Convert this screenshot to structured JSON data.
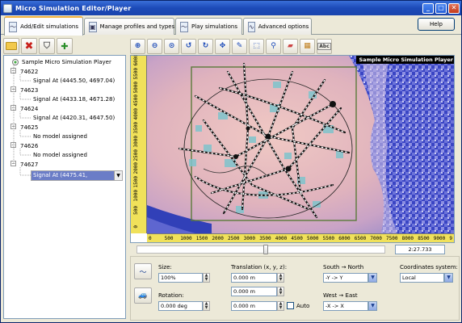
{
  "window": {
    "title": "Micro Simulation Editor/Player"
  },
  "tabs": [
    {
      "label": "Add/Edit simulations",
      "icon": "line-chart-icon"
    },
    {
      "label": "Manage profiles and types",
      "icon": "car-types-icon"
    },
    {
      "label": "Play simulations",
      "icon": "play-chart-icon"
    },
    {
      "label": "Advanced options",
      "icon": "advanced-chart-icon"
    }
  ],
  "help_label": "Help",
  "tree": {
    "root": "Sample Micro Simulation Player",
    "nodes": [
      {
        "id": "74622",
        "child": "Signal At (4445.50, 4697.04)"
      },
      {
        "id": "74623",
        "child": "Signal At (4433.18, 4671.28)"
      },
      {
        "id": "74624",
        "child": "Signal At (4420.31, 4647.50)"
      },
      {
        "id": "74625",
        "child": "No model assigned"
      },
      {
        "id": "74626",
        "child": "No model assigned"
      },
      {
        "id": "74627",
        "child": "Signal At (4475.41, 4692.98)"
      }
    ]
  },
  "map": {
    "badge": "Sample Micro Simulation Player",
    "v_ruler": [
      "0",
      "500",
      "1000",
      "1500",
      "2000",
      "2500",
      "3000",
      "3500",
      "4000",
      "4500",
      "5000",
      "5500",
      "6000"
    ],
    "h_ruler": [
      "0",
      "500",
      "1000",
      "1500",
      "2000",
      "2500",
      "3000",
      "3500",
      "4000",
      "4500",
      "5000",
      "5500",
      "6000",
      "6500",
      "7000",
      "7500",
      "8000",
      "8500",
      "9000",
      "9"
    ]
  },
  "playback": {
    "time": "2:27.733",
    "position": 0.52
  },
  "props": {
    "size_label": "Size:",
    "size_value": "100%",
    "rotation_label": "Rotation:",
    "rotation_value": "0.000 deg",
    "translation_label": "Translation (x, y, z):",
    "tx": "0.000 m",
    "ty": "0.000 m",
    "tz": "0.000 m",
    "auto_label": "Auto",
    "sn_label": "South → North",
    "sn_value": "-Y -> Y",
    "we_label": "West → East",
    "we_value": "-X -> X",
    "coord_label": "Coordinates system:",
    "coord_value": "Local"
  },
  "colors": {
    "title_bar": "#1c4ab8",
    "ruler": "#f0e15a",
    "selection": "#6b7dc7",
    "map_water": "#3140b8",
    "map_land": "#d9a9b8"
  }
}
